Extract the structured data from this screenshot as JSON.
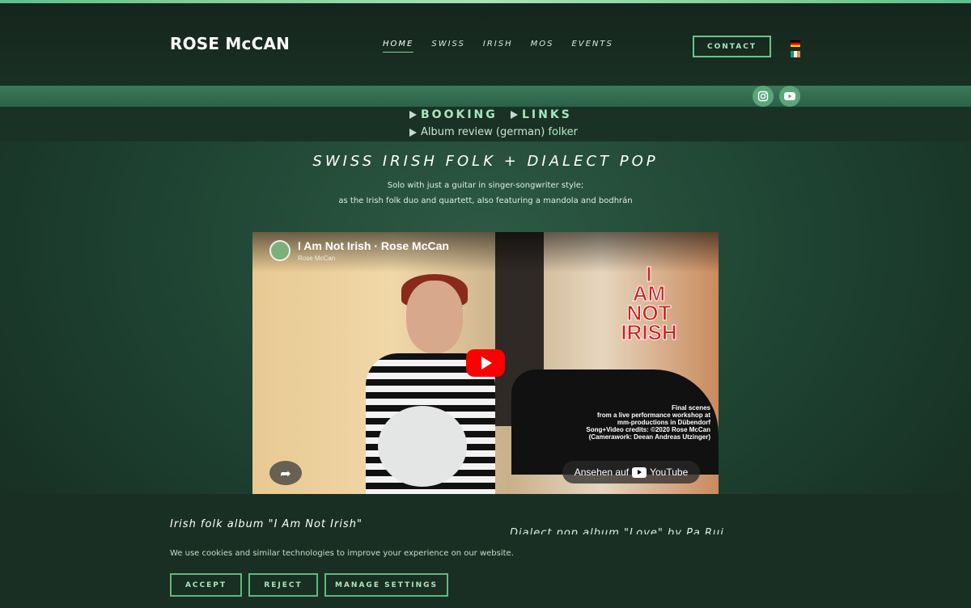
{
  "brand": "ROSE McCAN",
  "nav": {
    "items": [
      "HOME",
      "SWISS",
      "IRISH",
      "MOS",
      "EVENTS"
    ],
    "active": "HOME",
    "contact_label": "CONTACT"
  },
  "languages": [
    "de",
    "ie"
  ],
  "social": {
    "icons": [
      "instagram-icon",
      "youtube-icon"
    ]
  },
  "subnav": {
    "booking": "BOOKING",
    "links": "LINKS",
    "review_label": "Album review (german)",
    "review_link": "folker"
  },
  "hero": {
    "tagline": "SWISS IRISH FOLK + DIALECT POP",
    "line1": "Solo with just a guitar in singer-songwriter style;",
    "line2": "as the Irish folk duo and quartett, also featuring a mandola and bodhrán"
  },
  "video": {
    "title": "I Am Not Irish · Rose McCan",
    "channel": "Rose McCan",
    "overlay_words": [
      "I",
      "AM",
      "NOT",
      "IRISH"
    ],
    "credits": [
      "Final scenes",
      "from a live performance workshop at",
      "mm-productions in Dübendorf",
      "Song+Video credits: ©2020 Rose McCan",
      "(Camerawork: Deean Andreas Utzinger)"
    ],
    "watch_label": "Ansehen auf",
    "watch_platform": "YouTube"
  },
  "section": {
    "album_title": "Irish folk album \"I Am Not Irish\"",
    "right_heading": "Dialect pop album \"Love\" by Pa Rui"
  },
  "cookie": {
    "text": "We use cookies and similar technologies to improve your experience on our website.",
    "accept": "ACCEPT",
    "reject": "REJECT",
    "manage": "MANAGE SETTINGS"
  },
  "colors": {
    "accent": "#6cc48a",
    "background": "#1f4433",
    "header": "#15251d",
    "youtube_red": "#ff0000"
  }
}
